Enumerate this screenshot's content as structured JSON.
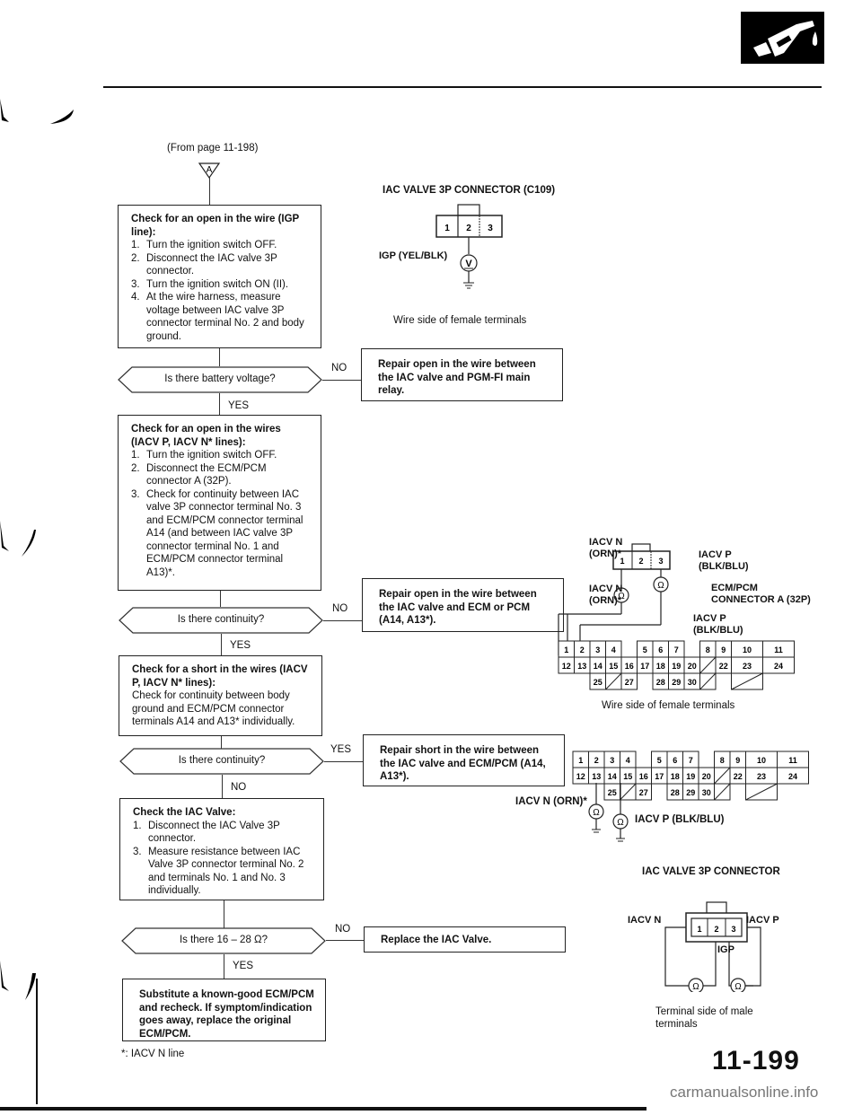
{
  "header": {
    "icon": "fuel-nozzle-icon"
  },
  "flow": {
    "from_page": "(From page 11-198)",
    "connector_marker": "A",
    "step1": {
      "title": "Check for an open in the wire (IGP line):",
      "steps": [
        {
          "n": "1.",
          "text": "Turn the ignition switch OFF."
        },
        {
          "n": "2.",
          "text": "Disconnect the IAC valve 3P connector."
        },
        {
          "n": "3.",
          "text": "Turn the ignition switch ON (II)."
        },
        {
          "n": "4.",
          "text": "At the wire harness, measure voltage between IAC valve 3P connector terminal No. 2 and body ground."
        }
      ]
    },
    "decision1": {
      "question": "Is there battery voltage?",
      "no": "NO",
      "yes": "YES"
    },
    "repair1": "Repair open in the wire between the IAC valve and PGM-FI main relay.",
    "step2": {
      "title": "Check for an open in the wires (IACV P, IACV N* lines):",
      "steps": [
        {
          "n": "1.",
          "text": "Turn the ignition switch OFF."
        },
        {
          "n": "2.",
          "text": "Disconnect the ECM/PCM connector A (32P)."
        },
        {
          "n": "3.",
          "text": "Check for continuity between IAC valve 3P connector terminal No. 3 and ECM/PCM connector terminal A14 (and between IAC valve 3P connector terminal No. 1 and ECM/PCM connector terminal A13)*."
        }
      ]
    },
    "decision2": {
      "question": "Is there continuity?",
      "no": "NO",
      "yes": "YES"
    },
    "repair2": "Repair open in the wire between the IAC valve and ECM or PCM (A14, A13*).",
    "step3": {
      "title": "Check for a short in the wires (IACV P, IACV N* lines):",
      "body": "Check for continuity between body ground and ECM/PCM connector terminals A14 and A13* individually."
    },
    "decision3": {
      "question": "Is there continuity?",
      "yes": "YES",
      "no": "NO"
    },
    "repair3": "Repair short in the wire between the IAC valve and ECM/PCM (A14, A13*).",
    "step4": {
      "title": "Check the IAC Valve:",
      "steps": [
        {
          "n": "1.",
          "text": "Disconnect the IAC Valve 3P connector."
        },
        {
          "n": "3.",
          "text": "Measure resistance between IAC Valve 3P connector terminal No. 2 and terminals No. 1 and No. 3 individually."
        }
      ]
    },
    "decision4": {
      "question": "Is there 16 – 28 Ω?",
      "no": "NO",
      "yes": "YES"
    },
    "repair4": "Replace the IAC Valve.",
    "final": "Substitute a known-good ECM/PCM and recheck. If symptom/indication goes away, replace the original ECM/PCM.",
    "footnote": "*: IACV N line"
  },
  "diagram1": {
    "title": "IAC VALVE 3P CONNECTOR (C109)",
    "pins": [
      "1",
      "2",
      "3"
    ],
    "wire_label": "IGP (YEL/BLK)",
    "meter": "V",
    "caption": "Wire side of female terminals"
  },
  "diagram2": {
    "iacv_n_top": "IACV N (ORN)*",
    "iacv_p_top": "IACV P (BLK/BLU)",
    "iacv_n_mid": "IACV N (ORN)*",
    "ecm_label": "ECM/PCM CONNECTOR A (32P)",
    "iacv_p_mid": "IACV P (BLK/BLU)",
    "pins": [
      "1",
      "2",
      "3"
    ],
    "meter": "Ω",
    "caption": "Wire side of female terminals"
  },
  "ecm_connector": {
    "row1": [
      "1",
      "2",
      "3",
      "4",
      "5",
      "6",
      "7",
      "8",
      "9",
      "10",
      "11"
    ],
    "row2": [
      "12",
      "13",
      "14",
      "15",
      "16",
      "17",
      "18",
      "19",
      "20",
      "22",
      "23",
      "24"
    ],
    "row3": [
      "25",
      "27",
      "28",
      "29",
      "30"
    ]
  },
  "diagram3": {
    "iacv_n": "IACV N (ORN)*",
    "iacv_p": "IACV P (BLK/BLU)",
    "meter": "Ω"
  },
  "diagram4": {
    "title": "IAC VALVE 3P CONNECTOR",
    "pins": [
      "1",
      "2",
      "3"
    ],
    "iacv_n": "IACV N",
    "iacv_p": "IACV P",
    "igp": "IGP",
    "meter": "Ω",
    "caption": "Terminal side of male terminals"
  },
  "footer": {
    "page_number": "11-199",
    "watermark": "carmanualsonline.info"
  }
}
